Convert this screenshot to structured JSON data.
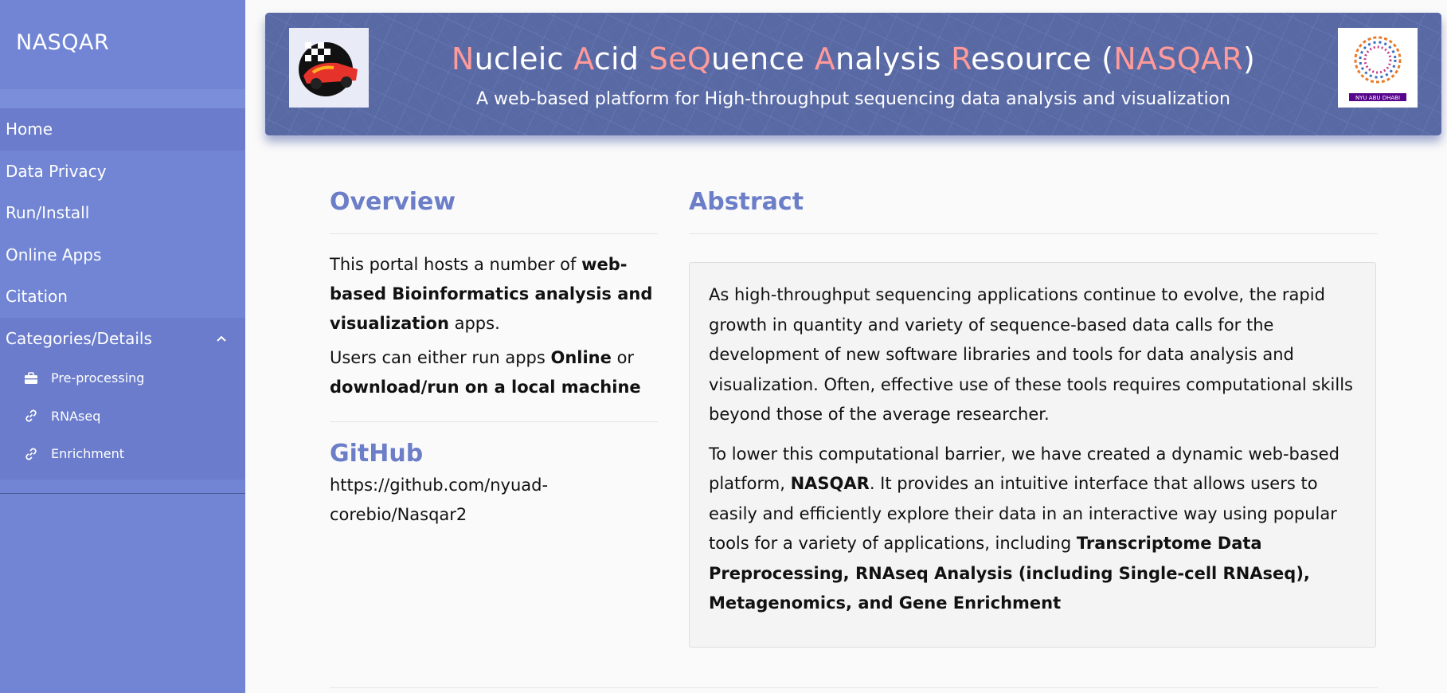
{
  "sidebar": {
    "brand": "NASQAR",
    "nav": [
      {
        "label": "Home"
      },
      {
        "label": "Data Privacy"
      },
      {
        "label": "Run/Install"
      },
      {
        "label": "Online Apps"
      },
      {
        "label": "Citation"
      }
    ],
    "category": {
      "label": "Categories/Details",
      "items": [
        {
          "label": "Pre-processing",
          "icon": "briefcase-icon"
        },
        {
          "label": "RNAseq",
          "icon": "link-icon"
        },
        {
          "label": "Enrichment",
          "icon": "link-icon"
        }
      ]
    }
  },
  "banner": {
    "title_parts": [
      {
        "text": "N",
        "hl": true
      },
      {
        "text": "ucleic ",
        "hl": false
      },
      {
        "text": "A",
        "hl": true
      },
      {
        "text": "cid ",
        "hl": false
      },
      {
        "text": "Se",
        "hl": true
      },
      {
        "text": "Q",
        "hl": true
      },
      {
        "text": "uence ",
        "hl": false
      },
      {
        "text": "A",
        "hl": true
      },
      {
        "text": "nalysis ",
        "hl": false
      },
      {
        "text": "R",
        "hl": true
      },
      {
        "text": "esource (",
        "hl": false
      },
      {
        "text": "NASQAR",
        "hl": true
      },
      {
        "text": ")",
        "hl": false
      }
    ],
    "subtitle": "A web-based platform for High-throughput sequencing data analysis and visualization",
    "right_logo_text": "NYU ABU DHABI",
    "colors": {
      "accent": "#ff9a9a",
      "background": "#5a6aab"
    }
  },
  "overview": {
    "heading": "Overview",
    "p1_a": "This portal hosts a number of ",
    "p1_b": "web-based Bioinformatics analysis and visualization",
    "p1_c": " apps.",
    "p2_a": "Users can either run apps ",
    "p2_b": "Online",
    "p2_c": " or ",
    "p2_d": "download/run on a local machine"
  },
  "github": {
    "heading": "GitHub",
    "url_line1": "https://github.com/nyuad-",
    "url_line2": "corebio/Nasqar2"
  },
  "abstract": {
    "heading": "Abstract",
    "p1": "As high-throughput sequencing applications continue to evolve, the rapid growth in quantity and variety of sequence-based data calls for the development of new software libraries and tools for data analysis and visualization. Often, effective use of these tools requires computational skills beyond those of the average researcher.",
    "p2_a": "To lower this computational barrier, we have created a dynamic web-based platform, ",
    "p2_b": "NASQAR",
    "p2_c": ". It provides an intuitive interface that allows users to easily and efficiently explore their data in an interactive way using popular tools for a variety of applications, including ",
    "p2_d": "Transcriptome Data Preprocessing, RNAseq Analysis (including Single-cell RNAseq), Metagenomics, and Gene Enrichment"
  },
  "colors": {
    "sidebar": "#7185d4",
    "heading": "#6c7ec8"
  }
}
